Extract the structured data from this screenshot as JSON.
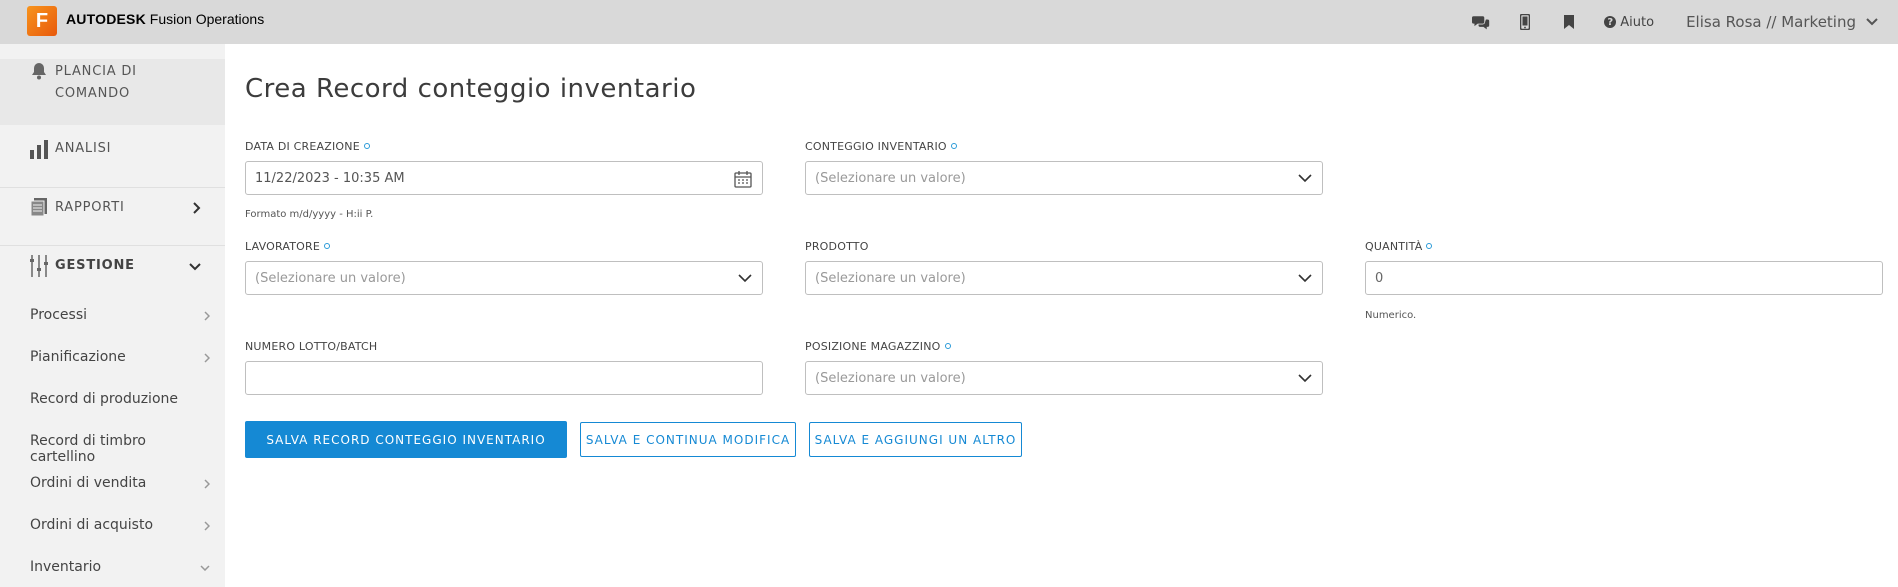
{
  "header": {
    "logo_letter": "F",
    "brand_bold": "AUTODESK",
    "brand_product": "Fusion Operations",
    "help_label": "Aiuto",
    "user_label": "Elisa Rosa // Marketing",
    "icons": [
      "chat-icon",
      "mobile-icon",
      "bookmark-icon",
      "help-icon"
    ]
  },
  "sidebar": {
    "main": [
      {
        "label": "PLANCIA DI COMANDO",
        "icon": "bell-icon"
      },
      {
        "label": "ANALISI",
        "icon": "bar-chart-icon"
      },
      {
        "label": "RAPPORTI",
        "icon": "reports-icon"
      },
      {
        "label": "GESTIONE",
        "icon": "sliders-icon"
      }
    ],
    "sub": [
      {
        "label": "Processi",
        "chevron": "right"
      },
      {
        "label": "Pianificazione",
        "chevron": "right"
      },
      {
        "label": "Record di produzione",
        "chevron": ""
      },
      {
        "label": "Record di timbro cartellino",
        "chevron": ""
      },
      {
        "label": "Ordini di vendita",
        "chevron": "right"
      },
      {
        "label": "Ordini di acquisto",
        "chevron": "right"
      },
      {
        "label": "Inventario",
        "chevron": "down"
      }
    ]
  },
  "form": {
    "title": "Crea Record conteggio inventario",
    "fields": {
      "data_creazione": {
        "label": "DATA DI CREAZIONE",
        "value": "11/22/2023 - 10:35 AM",
        "hint": "Formato m/d/yyyy - H:ii P."
      },
      "conteggio_inventario": {
        "label": "CONTEGGIO INVENTARIO",
        "placeholder": "(Selezionare un valore)"
      },
      "lavoratore": {
        "label": "LAVORATORE",
        "placeholder": "(Selezionare un valore)"
      },
      "prodotto": {
        "label": "PRODOTTO",
        "placeholder": "(Selezionare un valore)"
      },
      "quantita": {
        "label": "QUANTITÀ",
        "value": "0",
        "hint": "Numerico."
      },
      "numero_lotto": {
        "label": "NUMERO LOTTO/BATCH",
        "value": ""
      },
      "posizione_magazzino": {
        "label": "POSIZIONE MAGAZZINO",
        "placeholder": "(Selezionare un valore)"
      }
    },
    "buttons": {
      "save": "SALVA RECORD CONTEGGIO INVENTARIO",
      "save_continue": "SALVA E CONTINUA MODIFICA",
      "save_add": "SALVA E AGGIUNGI UN ALTRO"
    }
  },
  "colors": {
    "accent": "#1589d4",
    "required_dot": "#2a9ad8",
    "logo": "#f7941d"
  }
}
